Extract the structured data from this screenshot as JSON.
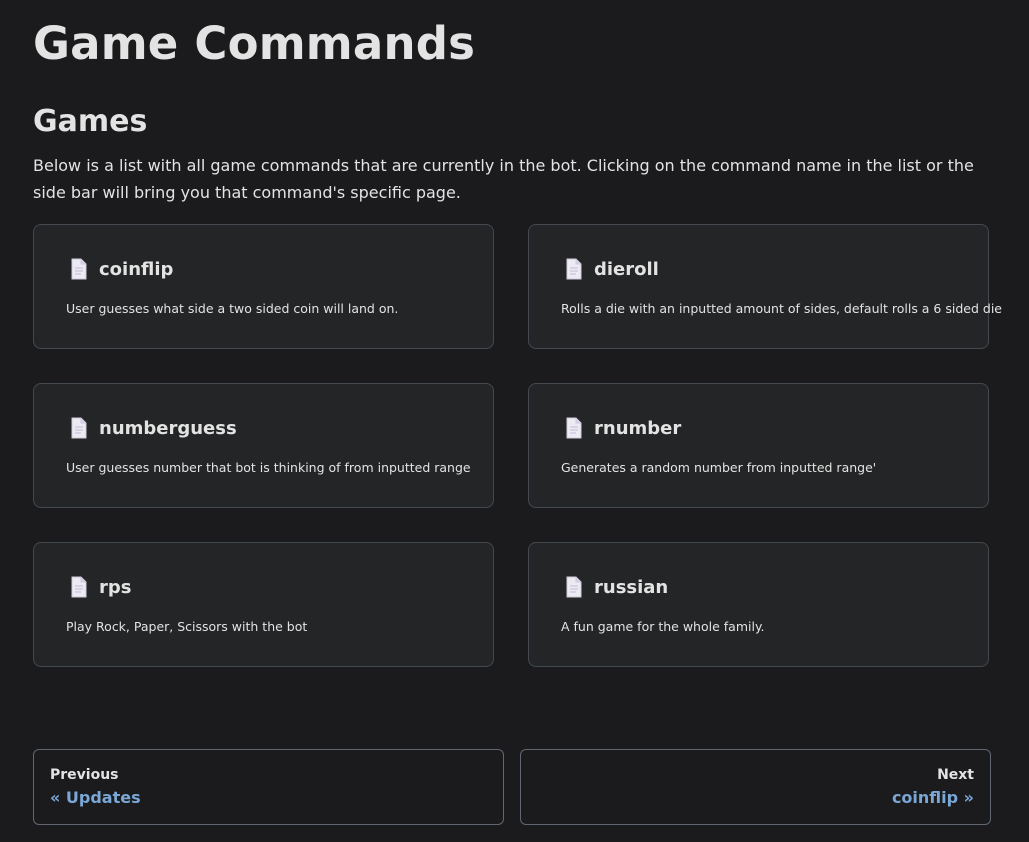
{
  "page": {
    "title": "Game Commands",
    "section_heading": "Games",
    "intro": "Below is a list with all game commands that are currently in the bot. Clicking on the command name in the list or the side bar will bring you that command's specific page."
  },
  "cards": [
    {
      "title": "coinflip",
      "description": "User guesses what side a two sided coin will land on.",
      "icon": "document-icon"
    },
    {
      "title": "dieroll",
      "description": "Rolls a die with an inputted amount of sides, default rolls a 6 sided die",
      "icon": "document-icon"
    },
    {
      "title": "numberguess",
      "description": "User guesses number that bot is thinking of from inputted range",
      "icon": "document-icon"
    },
    {
      "title": "rnumber",
      "description": "Generates a random number from inputted range'",
      "icon": "document-icon"
    },
    {
      "title": "rps",
      "description": "Play Rock, Paper, Scissors with the bot",
      "icon": "document-icon"
    },
    {
      "title": "russian",
      "description": "A fun game for the whole family.",
      "icon": "document-icon"
    }
  ],
  "pagination": {
    "previous": {
      "sublabel": "Previous",
      "label": "« Updates"
    },
    "next": {
      "sublabel": "Next",
      "label": "coinflip »"
    }
  },
  "colors": {
    "background": "#1b1b1d",
    "card_background": "#242526",
    "card_border": "#444950",
    "link": "#7aa7d6",
    "text": "#e3e3e3"
  }
}
